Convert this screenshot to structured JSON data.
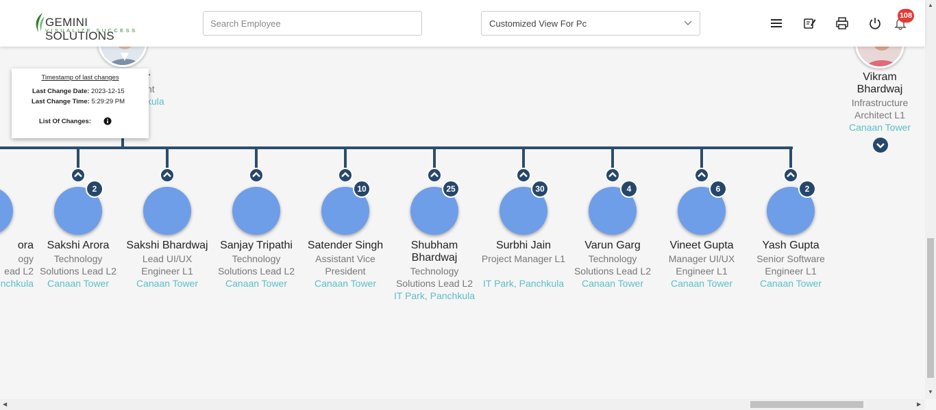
{
  "header": {
    "logo_name": "GEMINI SOLUTIONS",
    "logo_tagline": "VISUALIZE SUCCESS",
    "search_placeholder": "Search Employee",
    "view_selected": "Customized View For Pc",
    "notification_count": "108",
    "icons": [
      "menu-icon",
      "edit-note-icon",
      "print-icon",
      "power-icon",
      "bell-icon"
    ]
  },
  "top_left_person": {
    "name_partial": "r",
    "title_partial": "nt",
    "location_partial": "kula"
  },
  "top_right_person": {
    "name": "Vikram Bhardwaj",
    "title": "Infrastructure Architect L1",
    "location": "Canaan Tower"
  },
  "tooltip": {
    "heading": "Timestamp of last changes",
    "date_label": "Last Change Date:",
    "date_value": "2023-12-15",
    "time_label": "Last Change Time:",
    "time_value": "5:29:29 PM",
    "changes_label": "List Of Changes:"
  },
  "partial_node": {
    "name": "ora",
    "title_line1": "ogy",
    "title_line2": "ead L2",
    "location": "nchkula"
  },
  "nodes": [
    {
      "name": "Sakshi Arora",
      "title": "Technology Solutions Lead L2",
      "location": "Canaan Tower",
      "count": "2"
    },
    {
      "name": "Sakshi Bhardwaj",
      "title": "Lead UI/UX Engineer L1",
      "location": "Canaan Tower",
      "count": ""
    },
    {
      "name": "Sanjay Tripathi",
      "title": "Technology Solutions Lead L2",
      "location": "Canaan Tower",
      "count": ""
    },
    {
      "name": "Satender Singh",
      "title": "Assistant Vice President",
      "location": "Canaan Tower",
      "count": "10"
    },
    {
      "name": "Shubham Bhardwaj",
      "title": "Technology Solutions Lead L2",
      "location": "IT Park, Panchkula",
      "count": "25"
    },
    {
      "name": "Surbhi Jain",
      "title": "Project Manager L1",
      "location": "IT Park, Panchkula",
      "count": "30"
    },
    {
      "name": "Varun Garg",
      "title": "Technology Solutions Lead L2",
      "location": "Canaan Tower",
      "count": "4"
    },
    {
      "name": "Vineet Gupta",
      "title": "Manager UI/UX Engineer L1",
      "location": "Canaan Tower",
      "count": "6"
    },
    {
      "name": "Yash Gupta",
      "title": "Senior Software Engineer L1",
      "location": "Canaan Tower",
      "count": "2"
    }
  ],
  "colors": {
    "connector": "#2c4d6e",
    "node_circle": "#6f9ee8",
    "location_text": "#5bbfc7",
    "badge_red": "#e53935"
  }
}
